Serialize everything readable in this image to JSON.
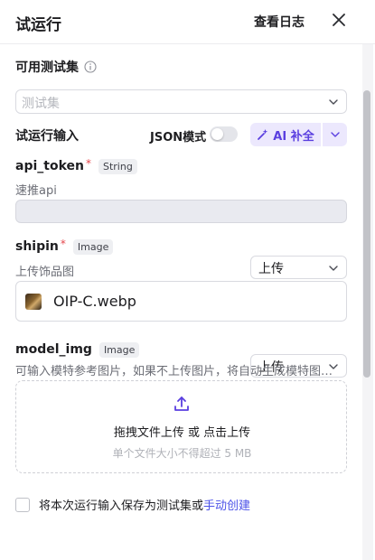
{
  "header": {
    "title": "试运行",
    "log_link": "查看日志"
  },
  "test_set": {
    "label": "可用测试集",
    "placeholder": "测试集"
  },
  "run_input": {
    "label": "试运行输入",
    "json_mode_label": "JSON模式",
    "ai_button_label": "AI 补全",
    "accent": "#5a3fe0"
  },
  "fields": [
    {
      "name": "api_token",
      "required": true,
      "type": "String",
      "desc": "速推api",
      "value": ""
    },
    {
      "name": "shipin",
      "required": true,
      "type": "Image",
      "desc": "上传饰品图",
      "mode": "上传",
      "file_name": "OIP-C.webp"
    },
    {
      "name": "model_img",
      "required": false,
      "type": "Image",
      "desc": "可输入模特参考图片，如果不上传图片，将自动生成模特图…",
      "mode": "上传"
    }
  ],
  "upload": {
    "main_text": "拖拽文件上传 或 点击上传",
    "hint": "单个文件大小不得超过 5 MB"
  },
  "footer": {
    "save_text": "将本次运行输入保存为测试集或",
    "manual_link": "手动创建"
  }
}
